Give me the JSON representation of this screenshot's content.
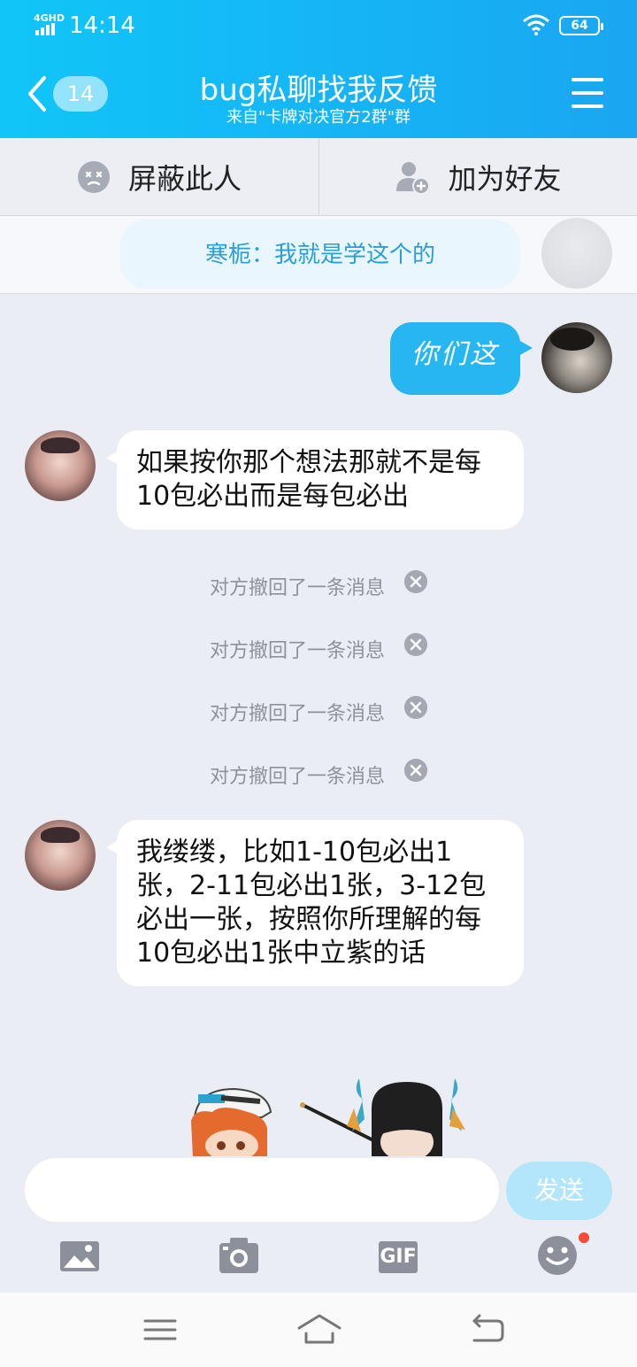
{
  "status_bar": {
    "network": "4GHD",
    "time": "14:14",
    "battery": "64"
  },
  "header": {
    "back_count": "14",
    "title": "bug私聊找我反馈",
    "subtitle": "来自\"卡牌对决官方2群\"群"
  },
  "actions": {
    "block": "屏蔽此人",
    "add_friend": "加为好友"
  },
  "pinned": {
    "text": "寒栀：我就是学这个的"
  },
  "messages": [
    {
      "side": "right",
      "text": "你们这"
    },
    {
      "side": "left",
      "text": "如果按你那个想法那就不是每10包必出而是每包必出"
    },
    {
      "side": "left",
      "text": "我缕缕，比如1-10包必出1张，2-11包必出1张，3-12包必出一张，按照你所理解的每10包必出1张中立紫的话"
    }
  ],
  "recalled": [
    "对方撤回了一条消息",
    "对方撤回了一条消息",
    "对方撤回了一条消息",
    "对方撤回了一条消息"
  ],
  "input": {
    "placeholder": "",
    "send": "发送"
  },
  "toolbar": {
    "gif": "GIF"
  },
  "colors": {
    "header_start": "#10c6f8",
    "header_end": "#1aa6f2",
    "bubble_self": "#26b6f2",
    "send_disabled": "#b3e5fb"
  },
  "icons": [
    "back-chevron-icon",
    "menu-icon",
    "block-icon",
    "add-friend-icon",
    "image-icon",
    "camera-icon",
    "gif-icon",
    "emoji-icon",
    "nav-menu-icon",
    "nav-home-icon",
    "nav-back-icon"
  ]
}
